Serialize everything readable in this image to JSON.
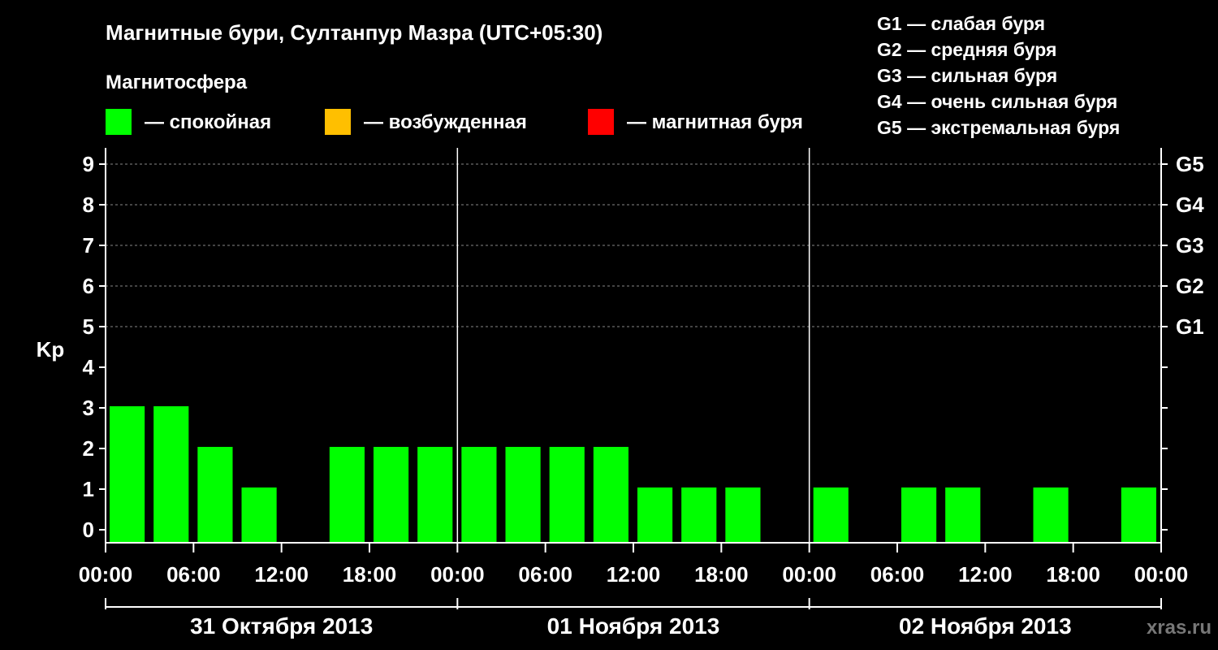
{
  "chart_data": {
    "type": "bar",
    "title": "Магнитные бури, Султанпур Мазра (UTC+05:30)",
    "subtitle": "Магнитосфера",
    "ylabel": "Kp",
    "ylim": [
      0,
      9
    ],
    "y_ticks": [
      "0",
      "1",
      "2",
      "3",
      "4",
      "5",
      "6",
      "7",
      "8",
      "9"
    ],
    "right_ticks": [
      {
        "value": 5,
        "label": "G1"
      },
      {
        "value": 6,
        "label": "G2"
      },
      {
        "value": 7,
        "label": "G3"
      },
      {
        "value": 8,
        "label": "G4"
      },
      {
        "value": 9,
        "label": "G5"
      }
    ],
    "x_ticks": [
      "00:00",
      "06:00",
      "12:00",
      "18:00",
      "00:00",
      "06:00",
      "12:00",
      "18:00",
      "00:00",
      "06:00",
      "12:00",
      "18:00",
      "00:00"
    ],
    "days": [
      "31 Октября 2013",
      "01 Ноября 2013",
      "02 Ноября 2013"
    ],
    "bar_hours": 3,
    "values": [
      3,
      3,
      2,
      1,
      0,
      2,
      2,
      2,
      2,
      2,
      2,
      2,
      1,
      1,
      1,
      0,
      1,
      0,
      1,
      1,
      0,
      1,
      0,
      1
    ],
    "legend": [
      {
        "label": "— спокойная",
        "color": "#00ff00"
      },
      {
        "label": "— возбужденная",
        "color": "#ffbf00"
      },
      {
        "label": "— магнитная буря",
        "color": "#ff0000"
      }
    ],
    "storm_scale": [
      "G1 — слабая буря",
      "G2 — средняя буря",
      "G3 — сильная буря",
      "G4 — очень сильная буря",
      "G5 — экстремальная буря"
    ],
    "colors": {
      "calm": "#00ff00",
      "grid": "#888888",
      "axis": "#ffffff",
      "background": "#000000"
    }
  },
  "watermark": "xras.ru"
}
